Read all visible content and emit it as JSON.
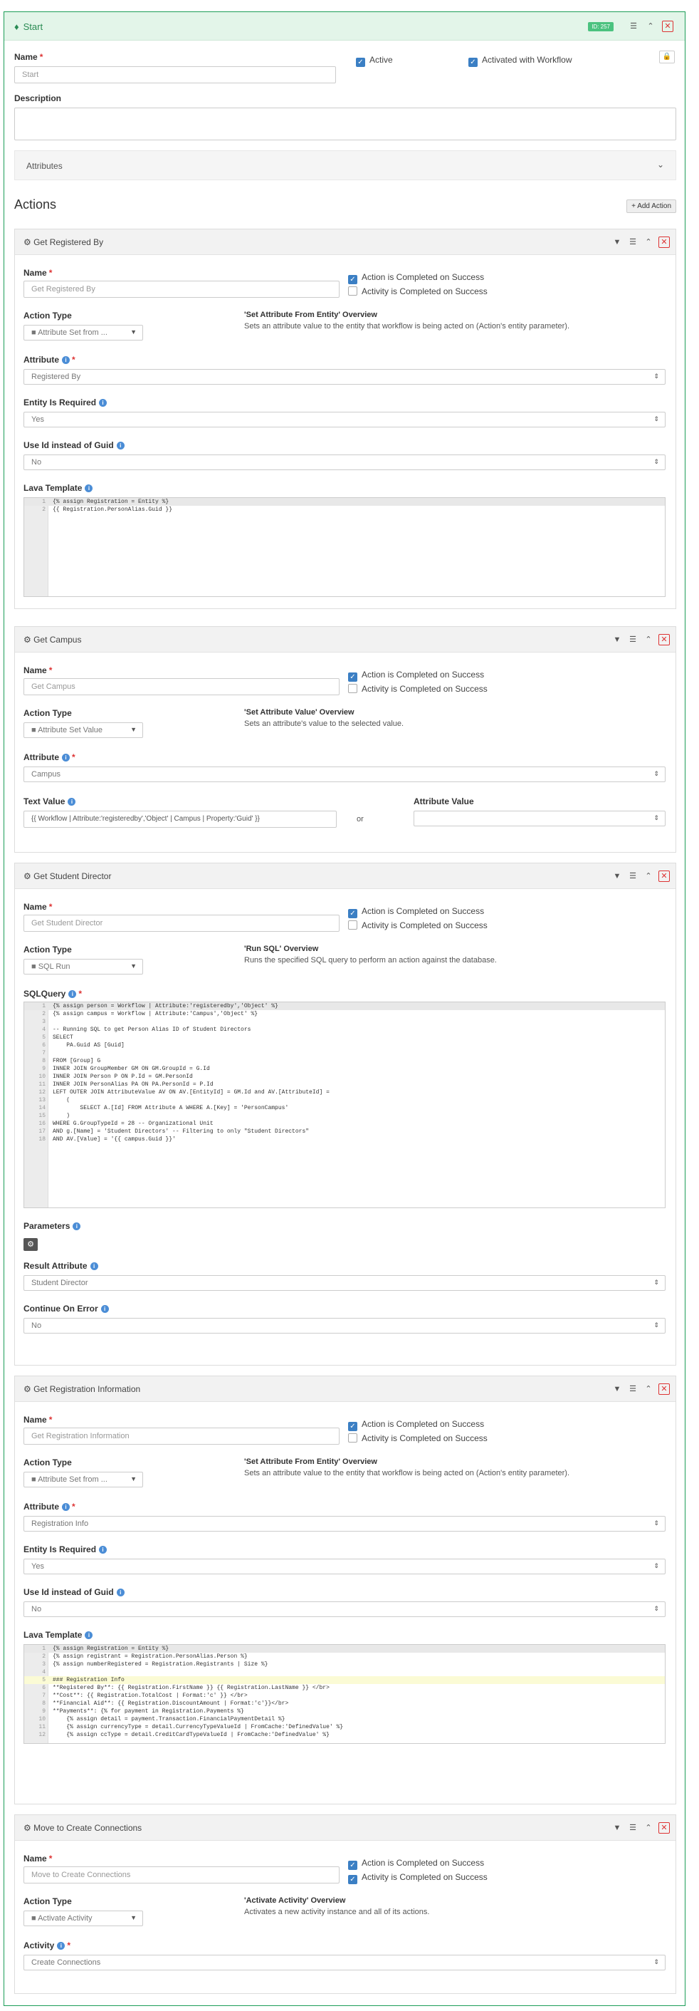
{
  "workflow": {
    "title": "Start",
    "badge": "ID: 257",
    "name_label": "Name",
    "name_placeholder": "Start",
    "active_label": "Active",
    "activated_label": "Activated with Workflow",
    "description_label": "Description",
    "attributes_label": "Attributes"
  },
  "actions": {
    "heading": "Actions",
    "add_label": "Add Action"
  },
  "common": {
    "name_label": "Name",
    "action_type_label": "Action Type",
    "attribute_label": "Attribute",
    "entity_required_label": "Entity Is Required",
    "use_id_label": "Use Id instead of Guid",
    "lava_template_label": "Lava Template",
    "action_completed": "Action is Completed on Success",
    "activity_completed": "Activity is Completed on Success"
  },
  "card1": {
    "title": "Get Registered By",
    "name_placeholder": "Get Registered By",
    "action_type": "Attribute Set from ...",
    "overview_title": "'Set Attribute From Entity' Overview",
    "overview_text": "Sets an attribute value to the entity that workflow is being acted on (Action's entity parameter).",
    "attribute": "Registered By",
    "entity_required": "Yes",
    "use_id": "No",
    "code": [
      "{% assign Registration = Entity %}",
      "{{ Registration.PersonAlias.Guid }}"
    ]
  },
  "card2": {
    "title": "Get Campus",
    "name_placeholder": "Get Campus",
    "action_type": "Attribute Set Value",
    "overview_title": "'Set Attribute Value' Overview",
    "overview_text": "Sets an attribute's value to the selected value.",
    "attribute": "Campus",
    "text_value_label": "Text Value",
    "text_value": "{{ Workflow | Attribute:'registeredby','Object' | Campus | Property:'Guid' }}",
    "or_label": "or",
    "attribute_value_label": "Attribute Value"
  },
  "card3": {
    "title": "Get Student Director",
    "name_placeholder": "Get Student Director",
    "action_type": "SQL Run",
    "overview_title": "'Run SQL' Overview",
    "overview_text": "Runs the specified SQL query to perform an action against the database.",
    "sql_label": "SQLQuery",
    "code": [
      "{% assign person = Workflow | Attribute:'registeredby','Object' %}",
      "{% assign campus = Workflow | Attribute:'Campus','Object' %}",
      "",
      "-- Running SQL to get Person Alias ID of Student Directors",
      "SELECT",
      "    PA.Guid AS [Guid]",
      "",
      "FROM [Group] G",
      "INNER JOIN GroupMember GM ON GM.GroupId = G.Id",
      "INNER JOIN Person P ON P.Id = GM.PersonId",
      "INNER JOIN PersonAlias PA ON PA.PersonId = P.Id",
      "LEFT OUTER JOIN AttributeValue AV ON AV.[EntityId] = GM.Id and AV.[AttributeId] =",
      "    (",
      "        SELECT A.[Id] FROM Attribute A WHERE A.[Key] = 'PersonCampus'",
      "    )",
      "WHERE G.GroupTypeId = 28 -- Organizational Unit",
      "AND g.[Name] = 'Student Directors' -- Filtering to only \"Student Directors\"",
      "AND AV.[Value] = '{{ campus.Guid }}'"
    ],
    "parameters_label": "Parameters",
    "result_attribute_label": "Result Attribute",
    "result_attribute": "Student Director",
    "continue_error_label": "Continue On Error",
    "continue_error": "No"
  },
  "card4": {
    "title": "Get Registration Information",
    "name_placeholder": "Get Registration Information",
    "action_type": "Attribute Set from ...",
    "overview_title": "'Set Attribute From Entity' Overview",
    "overview_text": "Sets an attribute value to the entity that workflow is being acted on (Action's entity parameter).",
    "attribute": "Registration Info",
    "entity_required": "Yes",
    "use_id": "No",
    "code": [
      "{% assign Registration = Entity %}",
      "{% assign registrant = Registration.PersonAlias.Person %}",
      "{% assign numberRegistered = Registration.Registrants | Size %}",
      "",
      "### Registration Info",
      "**Registered By**: {{ Registration.FirstName }} {{ Registration.LastName }} </br>",
      "**Cost**: {{ Registration.TotalCost | Format:'c' }} </br>",
      "**Financial Aid**: {{ Registration.DiscountAmount | Format:'c'}}</br>",
      "**Payments**: {% for payment in Registration.Payments %}",
      "    {% assign detail = payment.Transaction.FinancialPaymentDetail %}",
      "    {% assign currencyType = detail.CurrencyTypeValueId | FromCache:'DefinedValue' %}",
      "    {% assign ccType = detail.CreditCardTypeValueId | FromCache:'DefinedValue' %}"
    ]
  },
  "card5": {
    "title": "Move to Create Connections",
    "name_placeholder": "Move to Create Connections",
    "action_type": "Activate Activity",
    "overview_title": "'Activate Activity' Overview",
    "overview_text": "Activates a new activity instance and all of its actions.",
    "activity_label": "Activity",
    "activity": "Create Connections"
  },
  "colors": {
    "accent": "#1c9d58",
    "header_bg": "#e3f5e9",
    "danger": "#dd3333",
    "checkbox": "#3b7fc4"
  }
}
